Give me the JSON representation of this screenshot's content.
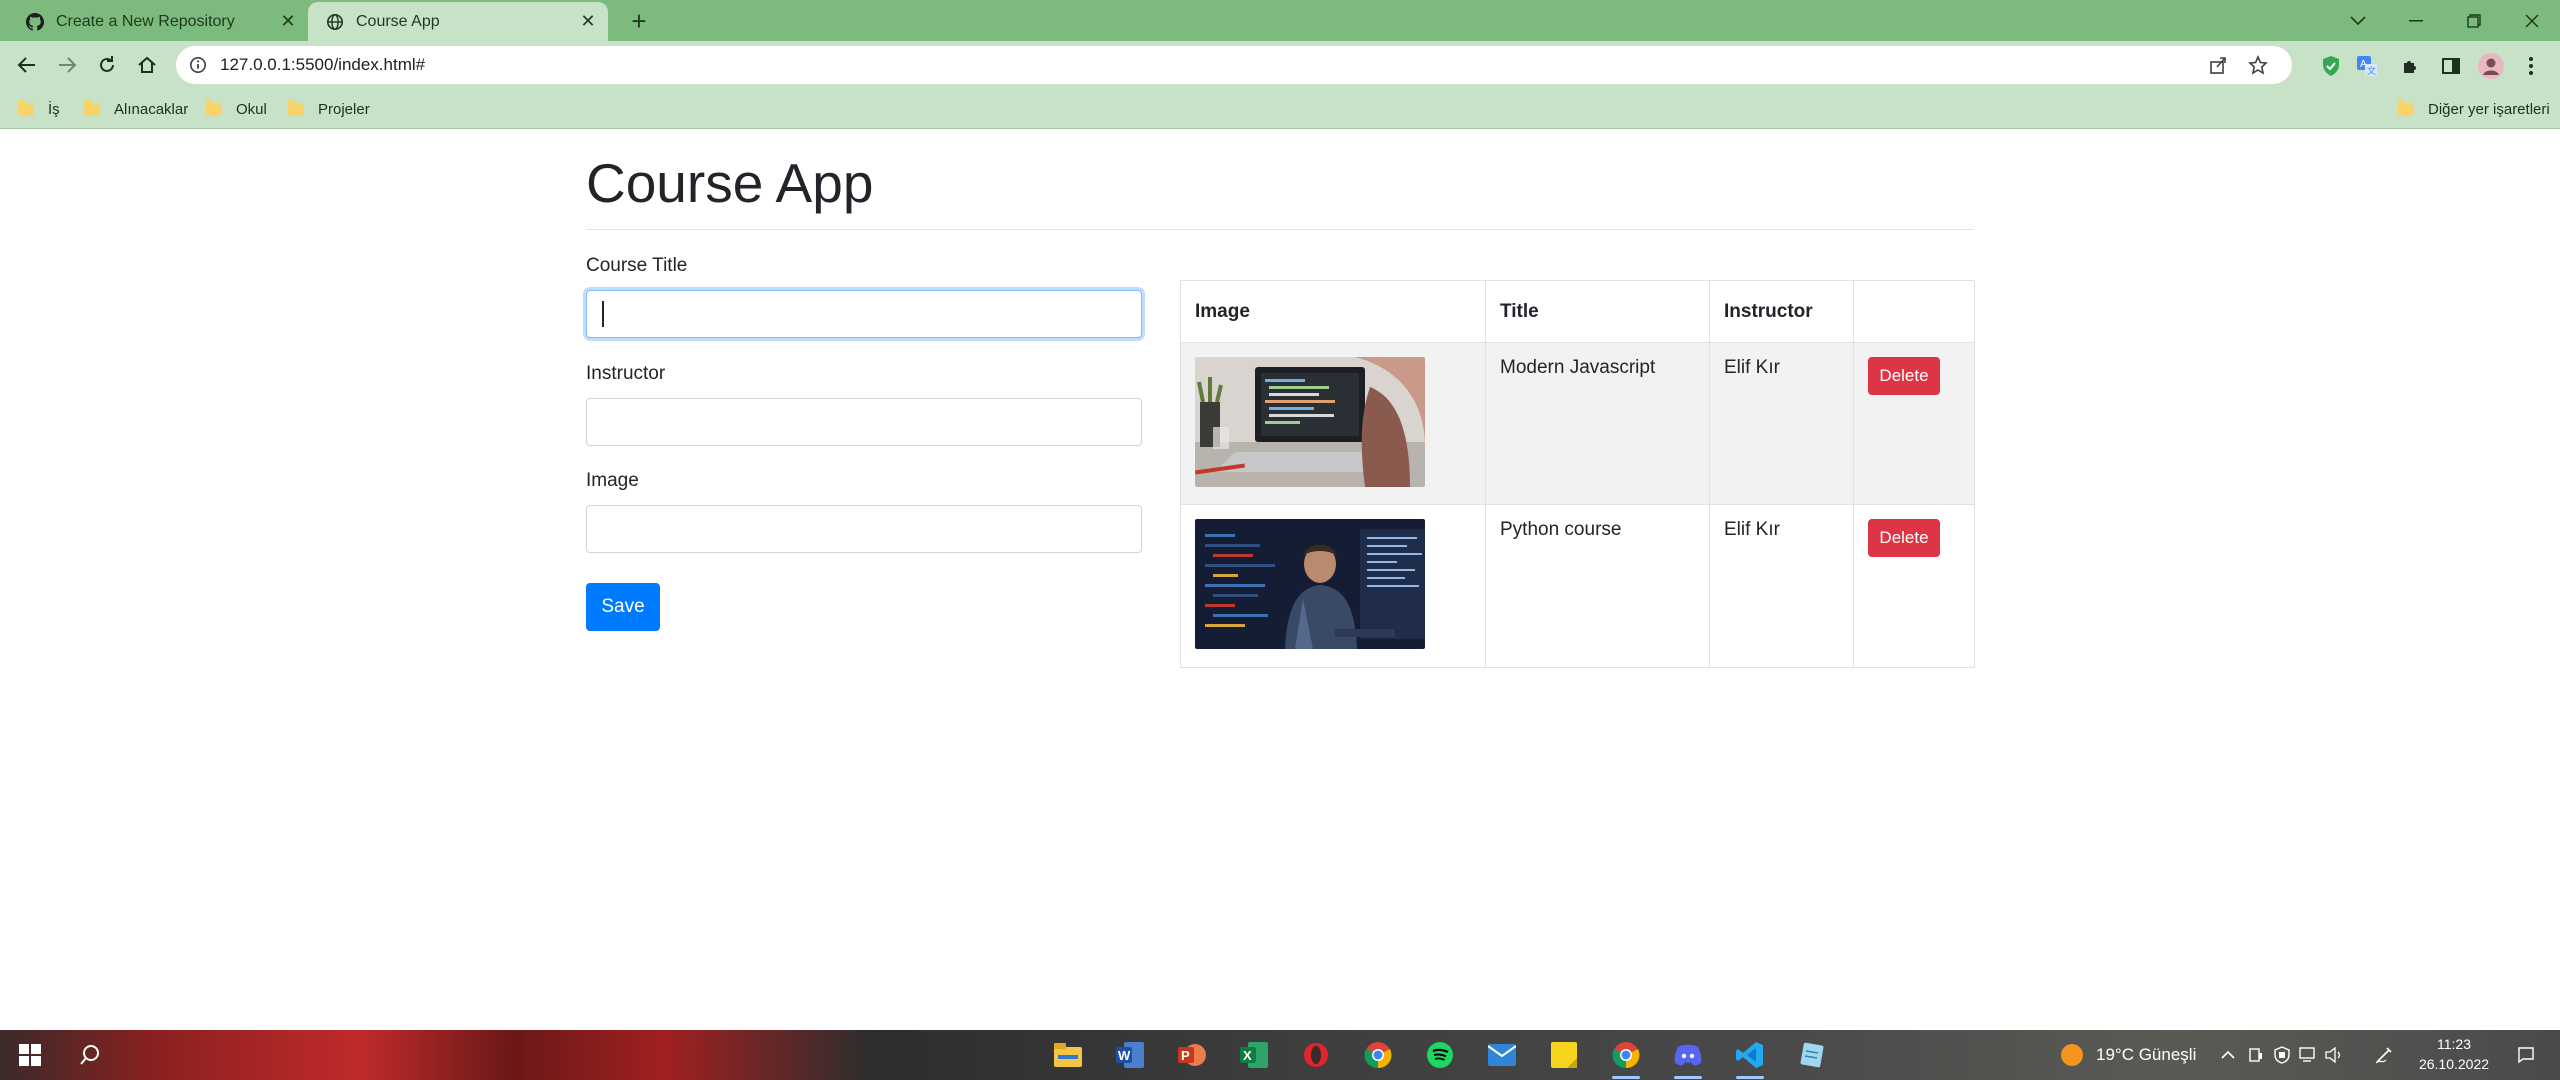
{
  "browser": {
    "tabs": [
      {
        "title": "Create a New Repository",
        "icon": "github-icon"
      },
      {
        "title": "Course App",
        "icon": "globe-icon"
      }
    ],
    "url": "127.0.0.1:5500/index.html#",
    "bookmarks": [
      "İş",
      "Alınacaklar",
      "Okul",
      "Projeler"
    ],
    "other_bookmarks": "Diğer yer işaretleri",
    "theme_color": "#7dba7d"
  },
  "page": {
    "title": "Course App",
    "form": {
      "title_label": "Course Title",
      "title_value": "",
      "instructor_label": "Instructor",
      "instructor_value": "",
      "image_label": "Image",
      "image_value": "",
      "save_label": "Save"
    },
    "table": {
      "headers": [
        "Image",
        "Title",
        "Instructor",
        ""
      ],
      "rows": [
        {
          "image": "laptop-code-photo",
          "title": "Modern Javascript",
          "instructor": "Elif Kır",
          "action": "Delete"
        },
        {
          "image": "developer-monitors-photo",
          "title": "Python course",
          "instructor": "Elif Kır",
          "action": "Delete"
        }
      ]
    },
    "colors": {
      "primary": "#007bff",
      "danger": "#dc3545",
      "stripe": "#f2f2f2"
    }
  },
  "taskbar": {
    "weather": "19°C  Güneşli",
    "time": "11:23",
    "date": "26.10.2022"
  }
}
